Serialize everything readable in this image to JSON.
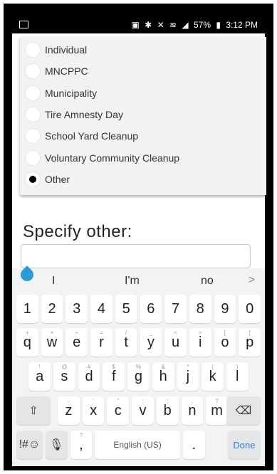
{
  "status_bar": {
    "icons": [
      "nfc-icon",
      "bluetooth-icon",
      "mute-icon",
      "wifi-icon",
      "signal-icon"
    ],
    "battery": "57%",
    "time": "3:12 PM"
  },
  "options": [
    {
      "label": "Individual",
      "selected": false
    },
    {
      "label": "MNCPPC",
      "selected": false
    },
    {
      "label": "Municipality",
      "selected": false
    },
    {
      "label": "Tire Amnesty Day",
      "selected": false
    },
    {
      "label": "School Yard Cleanup",
      "selected": false
    },
    {
      "label": "Voluntary Community Cleanup",
      "selected": false
    },
    {
      "label": "Other",
      "selected": true
    }
  ],
  "specify": {
    "title": "Specify other:",
    "value": ""
  },
  "keyboard": {
    "suggestions": [
      "I",
      "I'm",
      "no"
    ],
    "numbers": [
      "1",
      "2",
      "3",
      "4",
      "5",
      "6",
      "7",
      "8",
      "9",
      "0"
    ],
    "row1": [
      "q",
      "w",
      "e",
      "r",
      "t",
      "y",
      "u",
      "i",
      "o",
      "p"
    ],
    "row1_hints": [
      "+",
      "×",
      "÷",
      "=",
      "/",
      "_",
      "<",
      ">",
      "[",
      "]"
    ],
    "row2": [
      "a",
      "s",
      "d",
      "f",
      "g",
      "h",
      "j",
      "k",
      "l"
    ],
    "row2_hints": [
      "!",
      "@",
      "#",
      "$",
      "%",
      "&",
      "*",
      "(",
      ")"
    ],
    "row3": [
      "z",
      "x",
      "c",
      "v",
      "b",
      "n",
      "m"
    ],
    "row3_hints": [
      "-",
      "'",
      "\"",
      ":",
      ";",
      ",",
      "?"
    ],
    "symbols_label": "!#☺",
    "comma": ",",
    "comma_hint": "?",
    "space_label": "English (US)",
    "period": ".",
    "done_label": "Done"
  }
}
